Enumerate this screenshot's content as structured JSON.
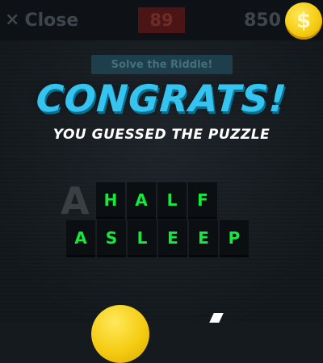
{
  "header": {
    "close_icon": "×",
    "close_label": "Close",
    "timer": "89",
    "coins": "850",
    "coin_symbol": "$"
  },
  "riddle_label": "Solve the Riddle!",
  "congrats_title": "CONGRATS!",
  "congrats_subtitle": "YOU GUESSED THE PUZZLE",
  "ghost_text": "A",
  "answer": {
    "row1": [
      "H",
      "A",
      "L",
      "F"
    ],
    "row2": [
      "A",
      "S",
      "L",
      "E",
      "E",
      "P"
    ]
  },
  "colors": {
    "title": "#35c4ef",
    "tile_letter": "#17e83c",
    "coin": "#f5cc12",
    "timer_bg": "#4a1514"
  },
  "icons": {
    "close": "close-icon",
    "coin": "dollar-coin-icon"
  }
}
